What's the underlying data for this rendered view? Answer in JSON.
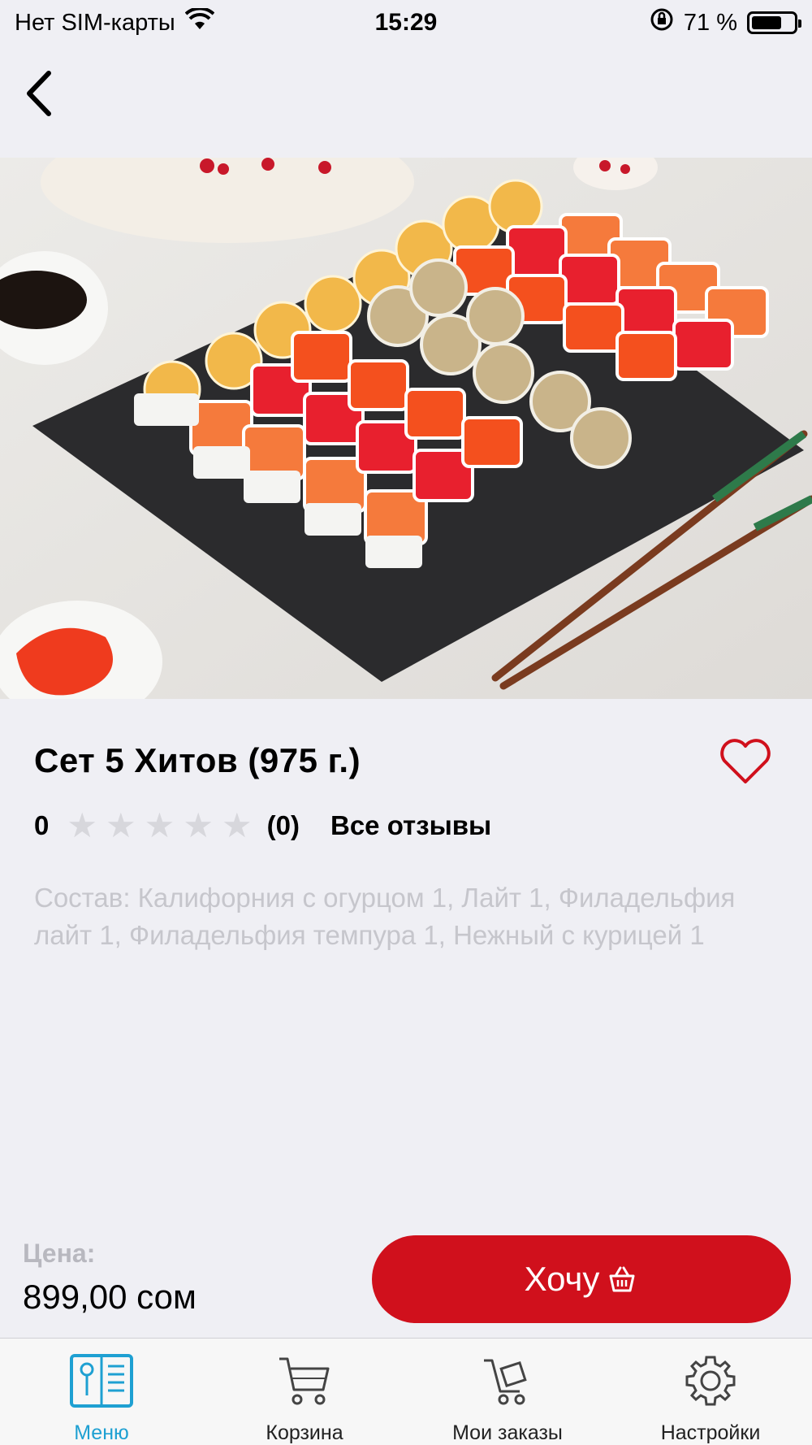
{
  "status_bar": {
    "carrier": "Нет SIM-карты",
    "time": "15:29",
    "battery": "71 %",
    "battery_level": 0.71,
    "icons": [
      "wifi-icon",
      "orientation-lock-icon",
      "battery-icon"
    ]
  },
  "nav": {
    "back_icon": "chevron-left-icon"
  },
  "product": {
    "title": "Сет 5 Хитов (975 г.)",
    "rating": "0",
    "rating_value": 0,
    "rating_max": 5,
    "reviews_count": "(0)",
    "all_reviews": "Все отзывы",
    "description": "Состав: Калифорния с огурцом 1, Лайт 1, Филадельфия лайт 1, Филадельфия темпура 1, Нежный с курицей 1",
    "favorite_icon": "heart-outline-icon"
  },
  "purchase": {
    "price_label": "Цена:",
    "price": "899,00 сом",
    "button_label": "Хочу",
    "button_icon": "basket-icon"
  },
  "tabs": [
    {
      "label": "Меню",
      "icon": "menu-book-icon",
      "active": true
    },
    {
      "label": "Корзина",
      "icon": "cart-icon",
      "active": false
    },
    {
      "label": "Мои заказы",
      "icon": "orders-cart-icon",
      "active": false
    },
    {
      "label": "Настройки",
      "icon": "gear-icon",
      "active": false
    }
  ],
  "colors": {
    "accent": "#d0101c",
    "tab_active": "#1ea0d2",
    "heart": "#d0101c",
    "muted_text": "#c6c6cc",
    "background": "#efeff4"
  }
}
